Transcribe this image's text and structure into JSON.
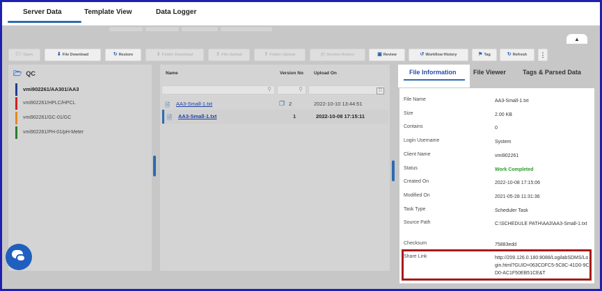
{
  "top_tabs": [
    {
      "label": "Server Data"
    },
    {
      "label": "Template View"
    },
    {
      "label": "Data Logger"
    }
  ],
  "collapse_icon": "chevron-up-icon",
  "toolbar": {
    "open": "Open",
    "file_download": "File Download",
    "restore": "Restore",
    "folder_download": "Folder Download",
    "file_upload": "File Upload",
    "folder_upload": "Folder Upload",
    "version_history": "Version History",
    "review": "Review",
    "workflow_history": "Workflow History",
    "tag": "Tag",
    "refresh": "Refresh",
    "more": "⋮"
  },
  "left_panel": {
    "root_folder": "QC",
    "items": [
      {
        "label": "vmi902261/AA301/AA3",
        "color": "#1f3f8f"
      },
      {
        "label": "vmi902261/HPLC/HPCL",
        "color": "#cc2222"
      },
      {
        "label": "vmi902261/GC-01/GC",
        "color": "#e08a1e"
      },
      {
        "label": "vmi902261/PH-01/pH-Meter",
        "color": "#2d7a2d"
      }
    ]
  },
  "file_list": {
    "headers": {
      "name": "Name",
      "version": "Version No",
      "upload": "Upload On"
    },
    "rows": [
      {
        "name": "AA3-Small-1.txt",
        "version": "2",
        "upload_on": "2022-10-10 13:44:51"
      },
      {
        "name": "AA3-Small-1.txt",
        "version": "1",
        "upload_on": "2022-10-08 17:15:11"
      }
    ]
  },
  "right_tabs": {
    "file_information": "File Information",
    "file_viewer": "File Viewer",
    "tags_parsed": "Tags & Parsed Data"
  },
  "file_info": {
    "file_name": {
      "label": "File Name",
      "value": "AA3-Small-1.txt"
    },
    "size": {
      "label": "Size",
      "value": "2.00 KB"
    },
    "contains": {
      "label": "Contains",
      "value": "0"
    },
    "login_username": {
      "label": "Login Username",
      "value": "System"
    },
    "client_name": {
      "label": "Client Name",
      "value": "vmi902261"
    },
    "status": {
      "label": "Status",
      "value": "Work Completed"
    },
    "created_on": {
      "label": "Created On",
      "value": "2022-10-08 17:15:06"
    },
    "modified_on": {
      "label": "Modified On",
      "value": "2021-05-28 11:31:36"
    },
    "task_type": {
      "label": "Task Type",
      "value": "Scheduler Task"
    },
    "source_path": {
      "label": "Source Path",
      "value": "C:\\SCHEDULE PATH\\AA3\\AA3-Small-1.txt"
    },
    "checksum": {
      "label": "Checksum",
      "value": "75883edd"
    },
    "share_link": {
      "label": "Share Link",
      "value": "http://209.126.0.180:8088/LogilabSDMS/Login.html?GUID=063CDFC5-5C8C-41D0-9CD0-AC1F50EB51CE&T"
    }
  },
  "colors": {
    "accent": "#2b6cb0",
    "status_complete": "#2e9a2e",
    "highlight_border": "#a51a1a",
    "frame_border": "#1f1fb0"
  }
}
